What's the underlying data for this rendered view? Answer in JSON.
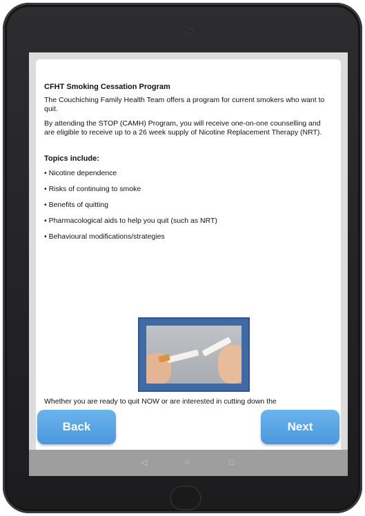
{
  "content": {
    "title": "CFHT Smoking Cessation Program",
    "para1": "The Couchiching Family Health Team offers a program for current smokers who want to quit.",
    "para2": "By attending the STOP (CAMH) Program, you will receive one-on-one counselling and are eligible to receive up to a 26 week supply of Nicotine Replacement Therapy (NRT).",
    "topics_heading": "Topics include:",
    "topics": [
      "• Nicotine dependence",
      "• Risks of continuing to smoke",
      "• Benefits of quitting",
      "• Pharmacological aids to help you quit (such as NRT)",
      "• Behavioural modifications/strategies"
    ],
    "bottom_text": "Whether you are ready to quit NOW or are interested in cutting down the"
  },
  "buttons": {
    "back": "Back",
    "next": "Next"
  },
  "navbar": {
    "back_icon": "◁",
    "home_icon": "○",
    "recent_icon": "□"
  },
  "icons": {
    "image": "broken-cigarette-image",
    "nav_back": "nav-back-icon",
    "nav_home": "nav-home-icon",
    "nav_recent": "nav-recent-icon"
  },
  "colors": {
    "button": "#5aa6e6",
    "image_frame": "#3f6aa6",
    "navbar": "#9e9e9e"
  }
}
